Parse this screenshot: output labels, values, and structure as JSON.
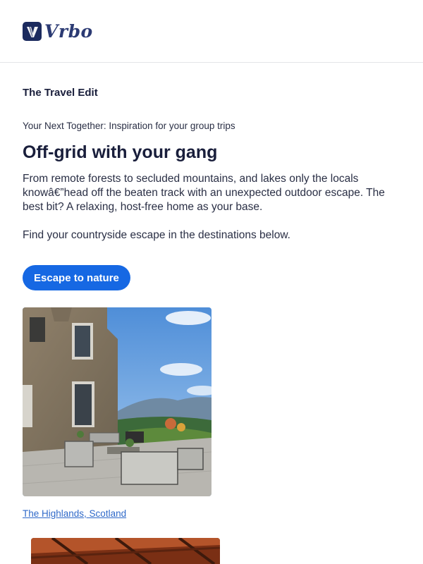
{
  "brand": {
    "name": "Vrbo",
    "mark_letter": "V",
    "colors": {
      "navy": "#1b2a5e",
      "accent_blue": "#1668e3"
    }
  },
  "newsletter": {
    "section_label": "The Travel Edit",
    "kicker": "Your Next Together: Inspiration for your group trips",
    "headline": "Off-grid with your gang",
    "body": "From remote forests to secluded mountains, and lakes only the locals knowâ€”head off the beaten track with an unexpected outdoor escape. The best bit? A relaxing, host-free home as your base.",
    "body_2": "Find your countryside escape in the destinations below.",
    "cta_label": "Escape to nature"
  },
  "destinations": [
    {
      "caption": "The Highlands, Scotland",
      "image": "stone-house-patio-photo"
    },
    {
      "image": "wooden-beam-ceiling-photo"
    }
  ]
}
